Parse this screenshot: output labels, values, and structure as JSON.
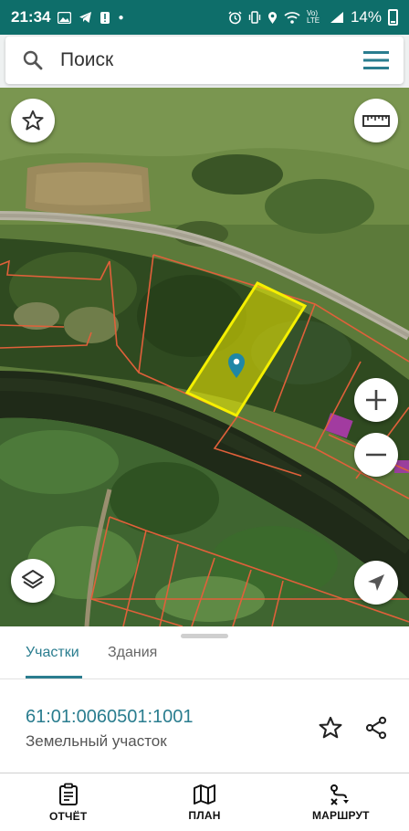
{
  "status_bar": {
    "time": "21:34",
    "network_label": "Vo) LTE",
    "battery": "14%"
  },
  "search": {
    "placeholder": "Поиск"
  },
  "map": {
    "selected_parcel_color": "#f5f000",
    "boundary_color": "#e0603a",
    "marker_color": "#1f87a6"
  },
  "sheet": {
    "tabs": [
      {
        "label": "Участки",
        "active": true
      },
      {
        "label": "Здания",
        "active": false
      }
    ],
    "parcel": {
      "number": "61:01:0060501:1001",
      "type": "Земельный участок"
    }
  },
  "bottom_nav": {
    "items": [
      {
        "label": "ОТЧЁТ",
        "icon": "report-icon"
      },
      {
        "label": "ПЛАН",
        "icon": "map-plan-icon"
      },
      {
        "label": "МАРШРУТ",
        "icon": "route-icon"
      }
    ]
  },
  "colors": {
    "status_bar": "#0e6e6a",
    "accent": "#2a7d8f"
  }
}
